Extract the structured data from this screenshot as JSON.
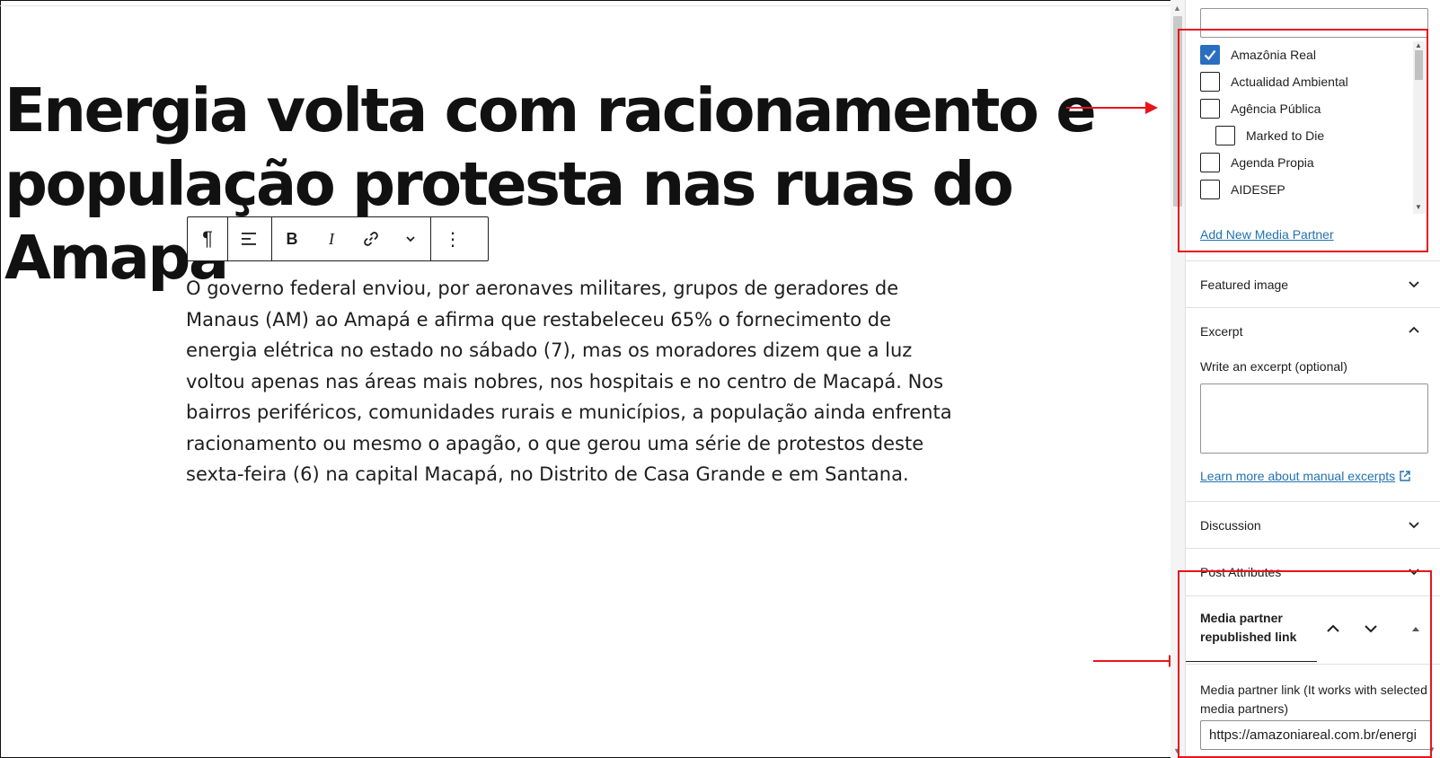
{
  "post": {
    "title": "Energia volta com racionamento e população protesta nas ruas do Amapá",
    "paragraph": "O governo federal enviou, por aeronaves militares, grupos de geradores de Manaus (AM) ao Amapá e afirma que restabeleceu 65% o fornecimento de energia elétrica no estado no sábado (7), mas os moradores dizem que a luz voltou apenas nas áreas mais nobres, nos hospitais e no centro de Macapá. Nos bairros periféricos, comunidades rurais e municípios, a população ainda enfrenta racionamento ou mesmo o apagão, o que gerou uma série de protestos deste sexta-feira (6) na capital Macapá, no Distrito de Casa Grande e em Santana."
  },
  "toolbar": {
    "paragraph_icon": "¶",
    "align_icon": "align-icon",
    "bold_label": "B",
    "italic_label": "I",
    "link_icon": "link-icon",
    "more_icon": "chevron-down-icon",
    "options_icon": "⋮"
  },
  "sidebar": {
    "media_partners": {
      "items": [
        {
          "label": "Amazônia Real",
          "checked": true
        },
        {
          "label": "Actualidad Ambiental",
          "checked": false
        },
        {
          "label": "Agência Pública",
          "checked": false
        },
        {
          "label": "Marked to Die",
          "checked": false
        },
        {
          "label": "Agenda Propia",
          "checked": false
        },
        {
          "label": "AIDESEP",
          "checked": false
        }
      ],
      "add_new_label": "Add New Media Partner"
    },
    "panels": {
      "featured_image": "Featured image",
      "excerpt": "Excerpt",
      "discussion": "Discussion",
      "post_attributes": "Post Attributes"
    },
    "excerpt": {
      "label": "Write an excerpt (optional)",
      "value": "",
      "learn_more": "Learn more about manual excerpts"
    },
    "media_partner_link": {
      "title": "Media partner republished link",
      "field_label": "Media partner link (It works with selected media partners)",
      "value": "https://amazoniareal.com.br/energi"
    }
  },
  "colors": {
    "accent": "#2a6fbf",
    "link": "#2271b1",
    "annotation": "#e8141b"
  }
}
